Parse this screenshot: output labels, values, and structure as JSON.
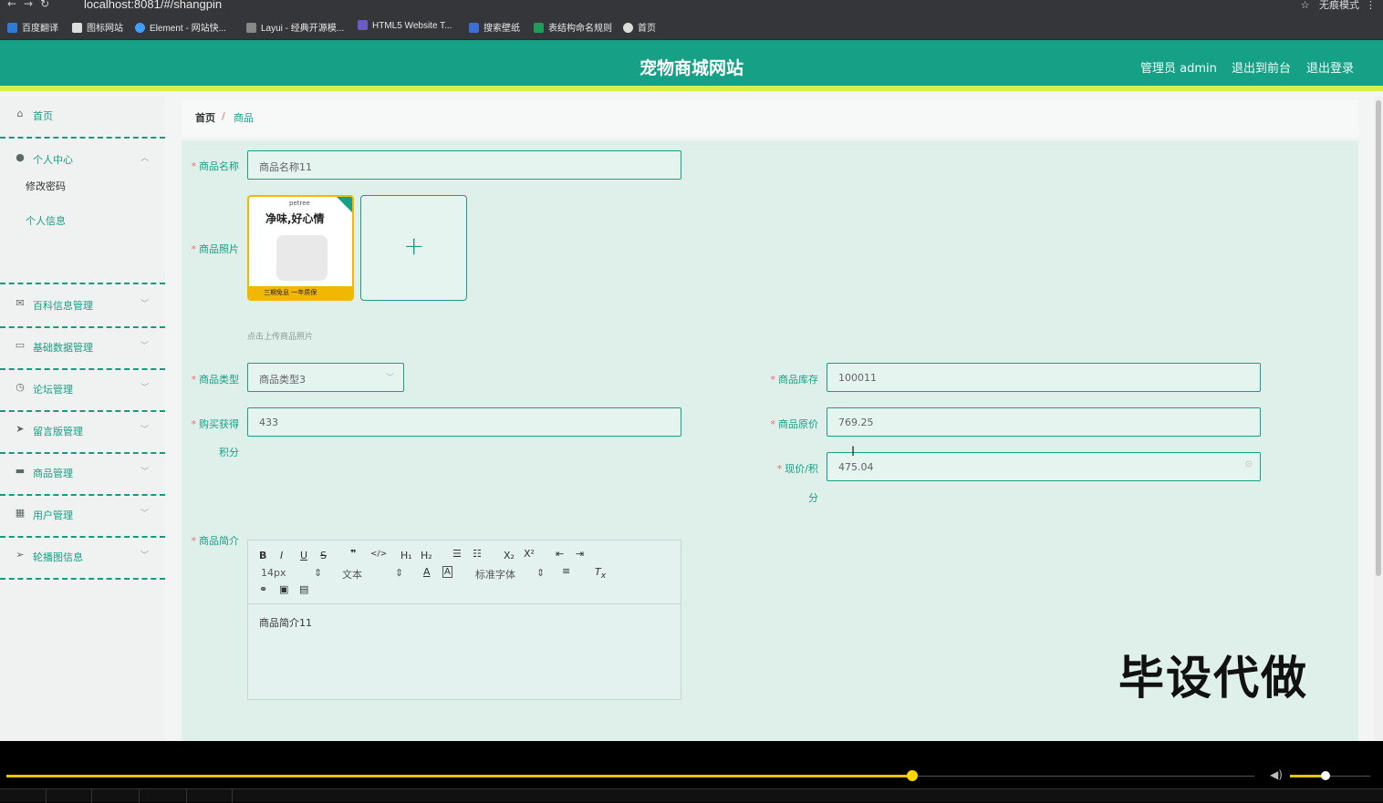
{
  "browser": {
    "url": "localhost:8081/#/shangpin",
    "profile": "无痕模式"
  },
  "bookmarks": [
    "百度翻译",
    "图标网站",
    "Element - 网站快...",
    "Layui - 经典开源模...",
    "HTML5 Website T...",
    "搜索壁纸",
    "表结构命名规则",
    "首页"
  ],
  "header": {
    "title": "宠物商城网站",
    "admin": "管理员 admin",
    "back_front": "退出到前台",
    "logout": "退出登录"
  },
  "sidebar": {
    "home": "首页",
    "personal": "个人中心",
    "change_password": "修改密码",
    "personal_info": "个人信息",
    "items": [
      "百科信息管理",
      "基础数据管理",
      "论坛管理",
      "留言版管理",
      "商品管理",
      "用户管理",
      "轮播图信息"
    ]
  },
  "breadcrumb": {
    "home": "首页",
    "sep": "/",
    "current": "商品"
  },
  "form": {
    "name_label": "商品名称",
    "name_value": "商品名称11",
    "photo_label": "商品照片",
    "photo_hint": "点击上传商品照片",
    "photo_text_brand": "petree",
    "photo_text_slogan": "净味,好心情",
    "photo_text_bottom": "三期免息  一年质保",
    "type_label": "商品类型",
    "type_value": "商品类型3",
    "stock_label": "商品库存",
    "stock_value": "100011",
    "points_label_1": "购买获得",
    "points_label_2": "积分",
    "points_value": "433",
    "price_label": "商品原价",
    "price_value": "769.25",
    "current_label_1": "现价/积",
    "current_label_2": "分",
    "current_value": "475.04",
    "desc_label": "商品简介",
    "desc_value": "商品简介11"
  },
  "editor": {
    "font_size": "14px",
    "text_type": "文本",
    "font_family": "标准字体"
  },
  "watermark": "毕设代做",
  "player": {
    "progress": 0.655,
    "volume": 0.45
  }
}
